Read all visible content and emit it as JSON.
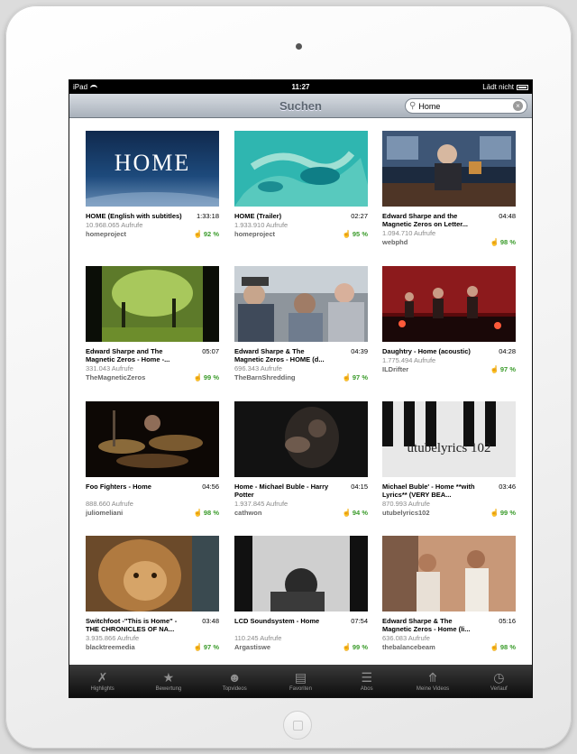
{
  "statusbar": {
    "carrier": "iPad",
    "time": "11:27",
    "loading": "Lädt nicht"
  },
  "navbar": {
    "title": "Suchen"
  },
  "search": {
    "query": "Home"
  },
  "videos": [
    {
      "title": "HOME (English with subtitles)",
      "duration": "1:33:18",
      "views": "10.968.065 Aufrufe",
      "author": "homeproject",
      "rating": "92 %"
    },
    {
      "title": "HOME (Trailer)",
      "duration": "02:27",
      "views": "1.933.910 Aufrufe",
      "author": "homeproject",
      "rating": "95 %"
    },
    {
      "title": "Edward Sharpe and the Magnetic Zeros on Letter...",
      "duration": "04:48",
      "views": "1.094.710 Aufrufe",
      "author": "webphd",
      "rating": "98 %"
    },
    {
      "title": "Edward Sharpe and The Magnetic Zeros - Home -...",
      "duration": "05:07",
      "views": "331.043 Aufrufe",
      "author": "TheMagneticZeros",
      "rating": "99 %"
    },
    {
      "title": "Edward Sharpe & The Magnetic Zeros - HOME (d...",
      "duration": "04:39",
      "views": "696.343 Aufrufe",
      "author": "TheBarnShredding",
      "rating": "97 %"
    },
    {
      "title": "Daughtry - Home (acoustic)",
      "duration": "04:28",
      "views": "1.775.494 Aufrufe",
      "author": "ILDrifter",
      "rating": "97 %"
    },
    {
      "title": "Foo Fighters - Home",
      "duration": "04:56",
      "views": "888.660 Aufrufe",
      "author": "juliomeliani",
      "rating": "98 %"
    },
    {
      "title": "Home - Michael Buble - Harry Potter",
      "duration": "04:15",
      "views": "1.937.845 Aufrufe",
      "author": "cathwon",
      "rating": "94 %"
    },
    {
      "title": "Michael Buble' - Home **with Lyrics** (VERY BEA...",
      "duration": "03:46",
      "views": "870.993 Aufrufe",
      "author": "utubelyrics102",
      "rating": "99 %"
    },
    {
      "title": "Switchfoot -\"This is Home\" - THE CHRONICLES OF NA...",
      "duration": "03:48",
      "views": "3.935.866 Aufrufe",
      "author": "blacktreemedia",
      "rating": "97 %"
    },
    {
      "title": "LCD Soundsystem - Home",
      "duration": "07:54",
      "views": "110.245 Aufrufe",
      "author": "Argastiswe",
      "rating": "99 %"
    },
    {
      "title": "Edward Sharpe & The Magnetic Zeros - Home (li...",
      "duration": "05:16",
      "views": "636.083 Aufrufe",
      "author": "thebalancebeam",
      "rating": "98 %"
    }
  ],
  "thumb1_text": "HOME",
  "thumb9_text": "utubelyrics 102",
  "tabs": [
    {
      "label": "Highlights",
      "icon": "highlights-icon"
    },
    {
      "label": "Bewertung",
      "icon": "star-icon"
    },
    {
      "label": "Topvideos",
      "icon": "people-icon"
    },
    {
      "label": "Favoriten",
      "icon": "book-icon"
    },
    {
      "label": "Abos",
      "icon": "subscriptions-icon"
    },
    {
      "label": "Meine Videos",
      "icon": "upload-icon"
    },
    {
      "label": "Verlauf",
      "icon": "clock-icon"
    }
  ],
  "colors": {
    "rating": "#3a9b2a",
    "navbar": "#a9b1bb",
    "tabbar": "#0d0d0d"
  }
}
